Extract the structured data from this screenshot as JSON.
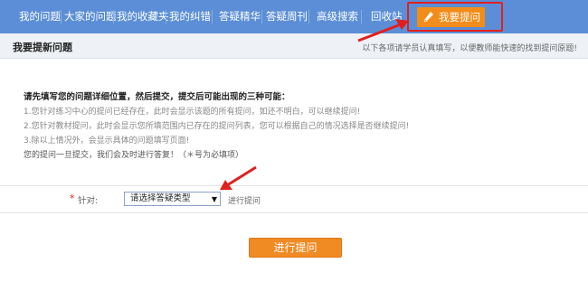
{
  "nav": {
    "items": [
      {
        "label": "我的问题"
      },
      {
        "label": "大家的问题"
      },
      {
        "label": "我的收藏夹"
      },
      {
        "label": "我的纠错"
      },
      {
        "label": "答疑精华"
      },
      {
        "label": "答疑周刊"
      },
      {
        "label": "高级搜索"
      },
      {
        "label": "回收站"
      }
    ],
    "ask_tab": {
      "label": "我要提问",
      "icon": "pencil-icon"
    }
  },
  "header": {
    "title": "我要提新问题",
    "note": "以下各项请学员认真填写，以便教师能快速的找到提问原题!"
  },
  "instructions": {
    "title": "请先填写您的问题详细位置，然后提交，提交后可能出现的三种可能：",
    "lines": [
      "1.您针对练习中心的提问已经存在，此时会显示该题的所有提问，如还不明白，可以继续提问!",
      "2.您针对教材提问，此时会显示您所填范围内已存在的提问列表，您可以根据自己的情况选择是否继续提问!",
      "3.除以上情况外，会显示具体的问题填写页面!"
    ],
    "last": "您的提问一旦提交，我们会及时进行答复！（＊号为必填项）"
  },
  "form": {
    "required_mark": "*",
    "label": "针对:",
    "select_value": "请选择答疑类型",
    "after_text": "进行提问"
  },
  "submit": {
    "label": "进行提问"
  },
  "colors": {
    "nav_bg": "#5b8ed6",
    "accent_orange": "#f28c1a",
    "highlight_red": "#e0201f"
  }
}
